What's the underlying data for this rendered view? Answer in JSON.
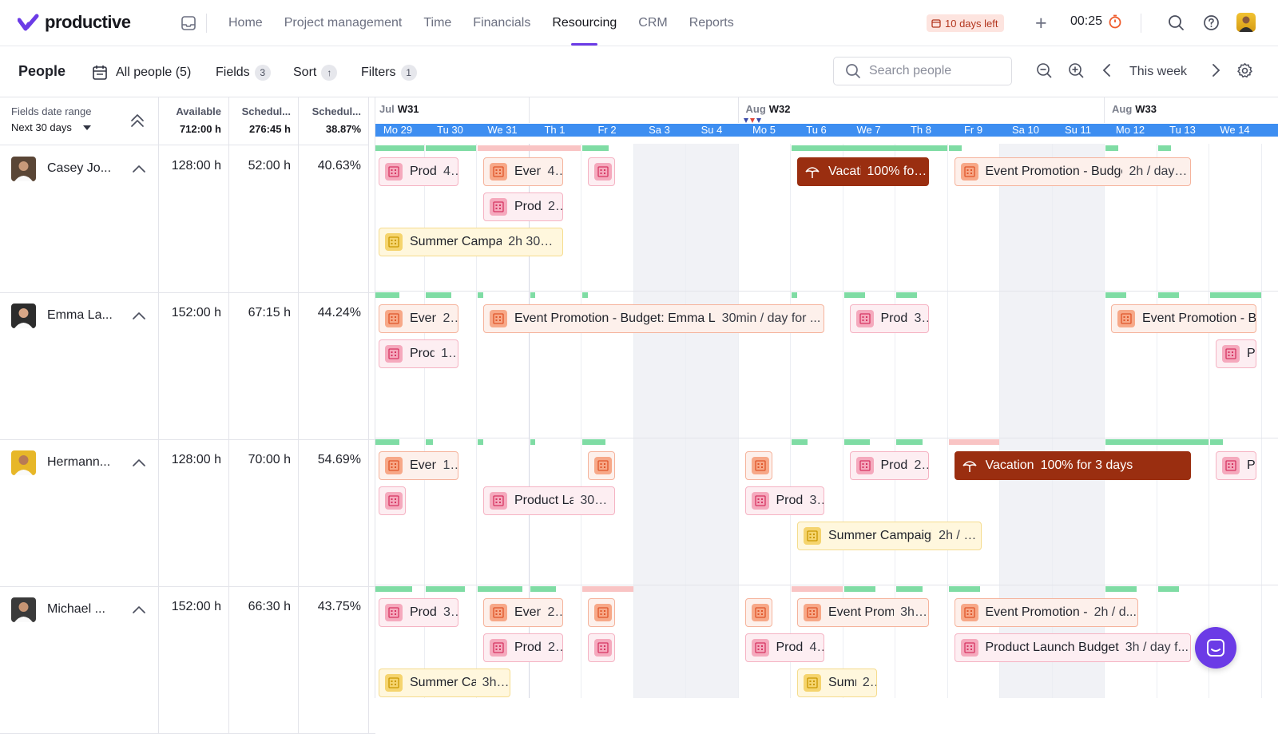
{
  "app": {
    "name": "productive"
  },
  "nav": {
    "links": [
      "Home",
      "Project management",
      "Time",
      "Financials",
      "Resourcing",
      "CRM",
      "Reports"
    ],
    "active": "Resourcing",
    "trial": "10 days left",
    "timer": "00:25"
  },
  "toolbar": {
    "title": "People",
    "all_people": "All people (5)",
    "fields_label": "Fields",
    "fields_count": "3",
    "sort_label": "Sort",
    "filters_label": "Filters",
    "filters_count": "1",
    "search_placeholder": "Search people",
    "week_label": "This week"
  },
  "left_header": {
    "date_range_title": "Fields date range",
    "date_range_value": "Next 30 days",
    "cols": [
      {
        "title": "Available",
        "total": "712:00 h"
      },
      {
        "title": "Schedul...",
        "total": "276:45 h"
      },
      {
        "title": "Schedul...",
        "total": "38.87%"
      }
    ]
  },
  "weeks": [
    {
      "month": "Jul",
      "week": "W31"
    },
    {
      "month": "Aug",
      "week": "W32"
    },
    {
      "month": "Aug",
      "week": "W33"
    }
  ],
  "days": [
    "Mo 29",
    "Tu 30",
    "We 31",
    "Th 1",
    "Fr 2",
    "Sa 3",
    "Su 4",
    "Mo 5",
    "Tu 6",
    "We 7",
    "Th 8",
    "Fr 9",
    "Sa 10",
    "Su 11",
    "Mo 12",
    "Tu 13",
    "We 14"
  ],
  "people": [
    {
      "name": "Casey Jo...",
      "available": "128:00 h",
      "scheduled": "52:00 h",
      "percent": "40.63%",
      "caps": [
        [
          "g",
          0,
          1
        ],
        [
          "g",
          1,
          1
        ],
        [
          "p",
          2,
          2
        ],
        [
          "g",
          4,
          0.5
        ],
        [
          "g",
          8,
          3
        ],
        [
          "g",
          11,
          0.25
        ],
        [
          "g",
          14,
          0.25
        ],
        [
          "g",
          15,
          0.25
        ]
      ],
      "bars": [
        {
          "t": "pink",
          "d": 0,
          "span": 1.75,
          "r": 0,
          "title": "Produ",
          "sub": "4..."
        },
        {
          "t": "orange",
          "d": 2,
          "span": 1.75,
          "r": 0,
          "title": "Event",
          "sub": "4..."
        },
        {
          "t": "pink",
          "d": 4,
          "span": 0.75,
          "r": 0,
          "title": "I",
          "sub": ""
        },
        {
          "t": "vac",
          "d": 8,
          "span": 2.75,
          "r": 0,
          "title": "Vacati",
          "sub": "100% for ..."
        },
        {
          "t": "orange",
          "d": 11,
          "span": 4.75,
          "r": 0,
          "title": "Event Promotion - Budge",
          "sub": "2h / day f..."
        },
        {
          "t": "pink",
          "d": 2,
          "span": 1.75,
          "r": 1,
          "title": "Produ",
          "sub": "2..."
        },
        {
          "t": "yellow",
          "d": 0,
          "span": 3.75,
          "r": 2,
          "title": "Summer Campai",
          "sub": "2h 30mi..."
        }
      ]
    },
    {
      "name": "Emma La...",
      "available": "152:00 h",
      "scheduled": "67:15 h",
      "percent": "44.24%",
      "caps": [
        [
          "g",
          0,
          0.5
        ],
        [
          "g",
          1,
          0.5
        ],
        [
          "g",
          2,
          0.1
        ],
        [
          "g",
          3,
          0.1
        ],
        [
          "g",
          4,
          0.1
        ],
        [
          "g",
          8,
          0.1
        ],
        [
          "g",
          9,
          0.4
        ],
        [
          "g",
          10,
          0.4
        ],
        [
          "g",
          14,
          0.4
        ],
        [
          "g",
          15,
          0.4
        ],
        [
          "g",
          16,
          1
        ]
      ],
      "bars": [
        {
          "t": "orange",
          "d": 0,
          "span": 1.75,
          "r": 0,
          "title": "Event",
          "sub": "2..."
        },
        {
          "t": "orange",
          "d": 2,
          "span": 6.75,
          "r": 0,
          "title": "Event Promotion - Budget: Emma L",
          "sub": "30min / day for ..."
        },
        {
          "t": "pink",
          "d": 9,
          "span": 1.75,
          "r": 0,
          "title": "Produ",
          "sub": "3..."
        },
        {
          "t": "orange",
          "d": 14,
          "span": 3,
          "r": 0,
          "title": "Event Promotion - B",
          "sub": ""
        },
        {
          "t": "pink",
          "d": 0,
          "span": 1.75,
          "r": 1,
          "title": "Prod",
          "sub": "1..."
        },
        {
          "t": "pink",
          "d": 16,
          "span": 1,
          "r": 1,
          "title": "P",
          "sub": ""
        }
      ]
    },
    {
      "name": "Hermann...",
      "available": "128:00 h",
      "scheduled": "70:00 h",
      "percent": "54.69%",
      "caps": [
        [
          "g",
          0,
          0.5
        ],
        [
          "g",
          1,
          0.15
        ],
        [
          "g",
          2,
          0.1
        ],
        [
          "g",
          3,
          0.1
        ],
        [
          "g",
          4,
          0.45
        ],
        [
          "g",
          8,
          0.3
        ],
        [
          "g",
          9,
          0.5
        ],
        [
          "g",
          10,
          0.5
        ],
        [
          "p",
          11,
          1
        ],
        [
          "g",
          14,
          2
        ],
        [
          "g",
          16,
          0.25
        ]
      ],
      "bars": [
        {
          "t": "orange",
          "d": 0,
          "span": 1.75,
          "r": 0,
          "title": "Event",
          "sub": "1..."
        },
        {
          "t": "orange",
          "d": 4,
          "span": 0.75,
          "r": 0,
          "title": "I",
          "sub": ""
        },
        {
          "t": "orange",
          "d": 7,
          "span": 0.75,
          "r": 0,
          "title": "I",
          "sub": ""
        },
        {
          "t": "pink",
          "d": 9,
          "span": 1.75,
          "r": 0,
          "title": "Produ",
          "sub": "2..."
        },
        {
          "t": "vac",
          "d": 11,
          "span": 4.75,
          "r": 0,
          "title": "Vacation",
          "sub": "100% for 3 days"
        },
        {
          "t": "pink",
          "d": 16,
          "span": 1,
          "r": 0,
          "title": "P",
          "sub": ""
        },
        {
          "t": "pink",
          "d": 0,
          "span": 0.75,
          "r": 1,
          "title": "I",
          "sub": ""
        },
        {
          "t": "pink",
          "d": 2,
          "span": 2.75,
          "r": 1,
          "title": "Product La",
          "sub": "30m..."
        },
        {
          "t": "pink",
          "d": 7,
          "span": 1.75,
          "r": 1,
          "title": "Produ",
          "sub": "3..."
        },
        {
          "t": "yellow",
          "d": 8,
          "span": 3.75,
          "r": 2,
          "title": "Summer Campaigi",
          "sub": "2h / d..."
        }
      ]
    },
    {
      "name": "Michael ...",
      "available": "152:00 h",
      "scheduled": "66:30 h",
      "percent": "43.75%",
      "caps": [
        [
          "g",
          0,
          0.75
        ],
        [
          "g",
          1,
          0.75
        ],
        [
          "g",
          2,
          0.85
        ],
        [
          "g",
          3,
          0.5
        ],
        [
          "p",
          4,
          1
        ],
        [
          "p",
          8,
          1
        ],
        [
          "g",
          9,
          0.6
        ],
        [
          "g",
          10,
          0.5
        ],
        [
          "g",
          11,
          0.6
        ],
        [
          "g",
          14,
          0.6
        ],
        [
          "g",
          15,
          0.4
        ]
      ],
      "bars": [
        {
          "t": "pink",
          "d": 0,
          "span": 1.75,
          "r": 0,
          "title": "Produ",
          "sub": "3..."
        },
        {
          "t": "orange",
          "d": 2,
          "span": 1.75,
          "r": 0,
          "title": "Event",
          "sub": "2..."
        },
        {
          "t": "orange",
          "d": 4,
          "span": 0.75,
          "r": 0,
          "title": "I",
          "sub": ""
        },
        {
          "t": "orange",
          "d": 7,
          "span": 0.75,
          "r": 0,
          "title": "I",
          "sub": ""
        },
        {
          "t": "orange",
          "d": 8,
          "span": 2.75,
          "r": 0,
          "title": "Event Prom",
          "sub": "3h ..."
        },
        {
          "t": "orange",
          "d": 11,
          "span": 3.75,
          "r": 0,
          "title": "Event Promotion -",
          "sub": "2h / d..."
        },
        {
          "t": "pink",
          "d": 2,
          "span": 1.75,
          "r": 1,
          "title": "Produ",
          "sub": "2..."
        },
        {
          "t": "pink",
          "d": 4,
          "span": 0.75,
          "r": 1,
          "title": "I",
          "sub": ""
        },
        {
          "t": "pink",
          "d": 7,
          "span": 1.75,
          "r": 1,
          "title": "Produ",
          "sub": "4..."
        },
        {
          "t": "pink",
          "d": 11,
          "span": 4.75,
          "r": 1,
          "title": "Product Launch Budget",
          "sub": "3h / day f..."
        },
        {
          "t": "yellow",
          "d": 0,
          "span": 2.75,
          "r": 2,
          "title": "Summer Ca",
          "sub": "3h ..."
        },
        {
          "t": "yellow",
          "d": 8,
          "span": 1.75,
          "r": 2,
          "title": "Summ",
          "sub": "2..."
        }
      ]
    }
  ],
  "colors": {
    "accent": "#6b3be6",
    "day_strip": "#3d8ef1",
    "cap_green": "#7fdca4",
    "cap_pink": "#f9c4c4",
    "vacation": "#9a2e10"
  }
}
